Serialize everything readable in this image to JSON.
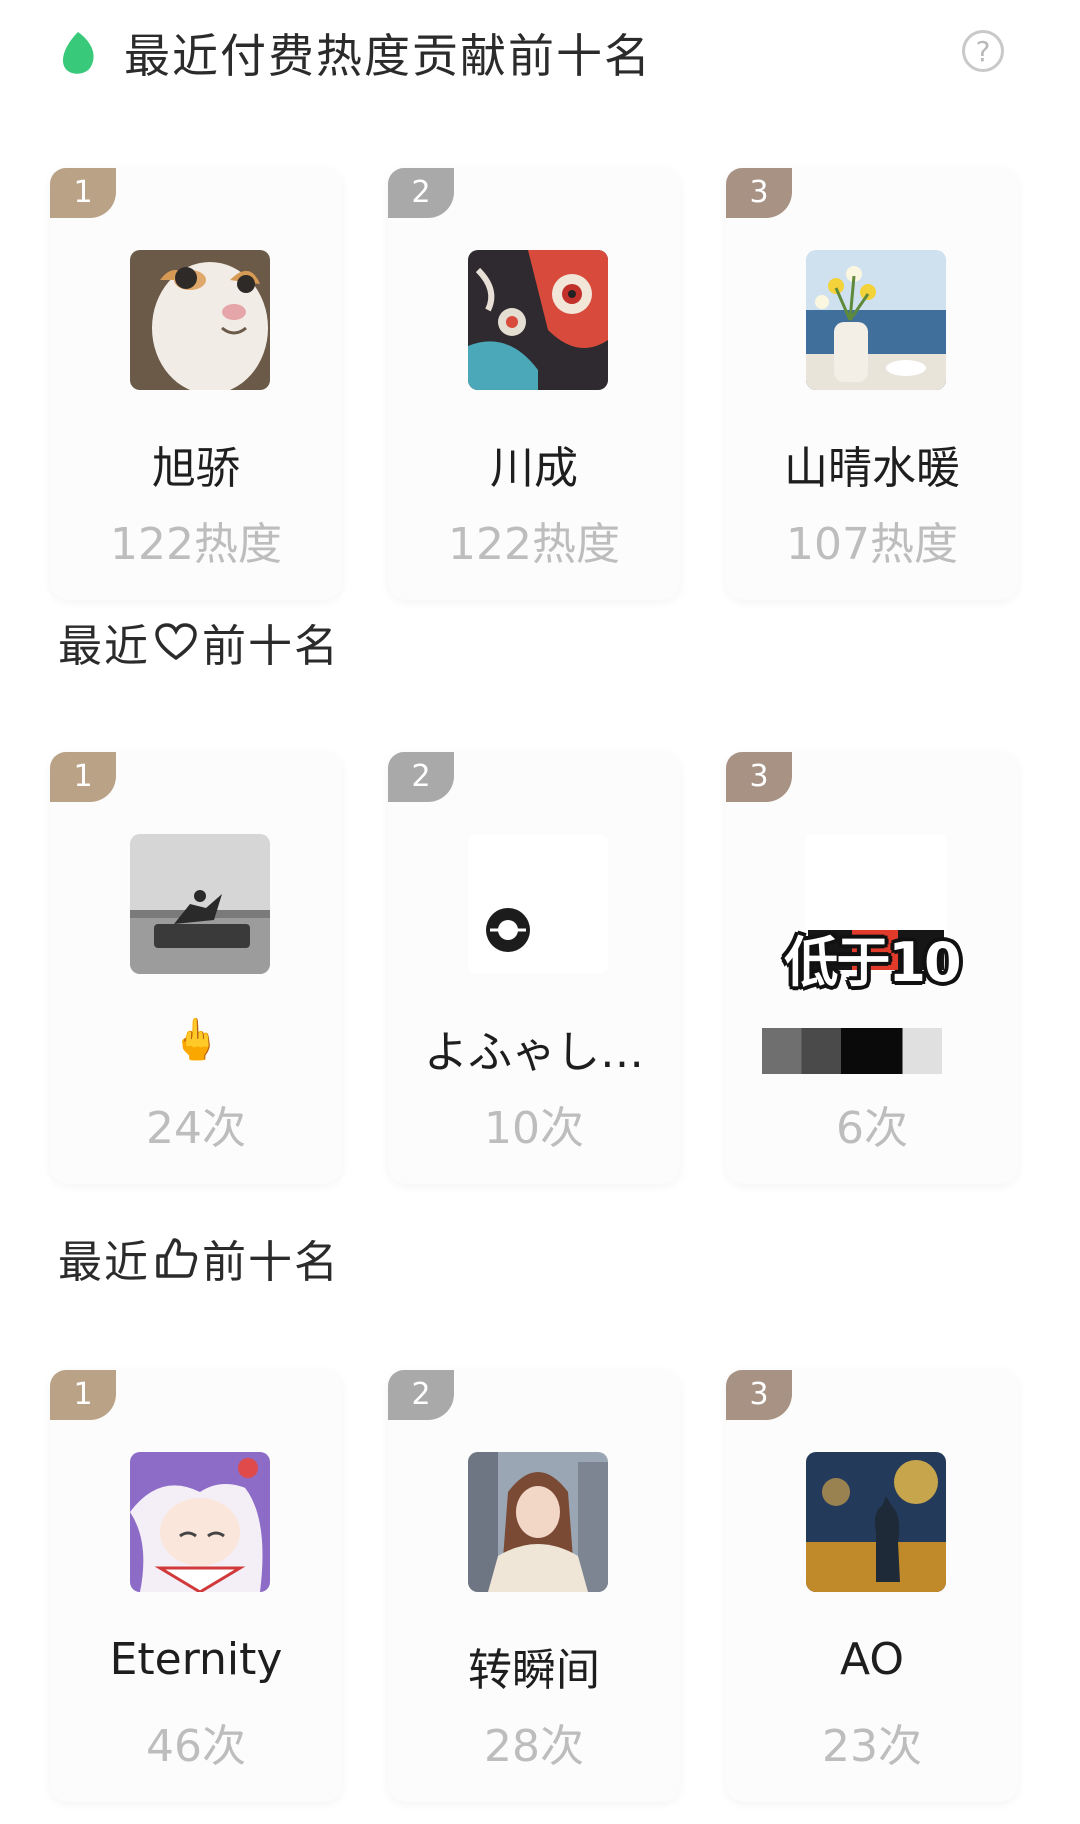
{
  "paid_section": {
    "title": "最近付费热度贡献前十名",
    "help_icon": "?",
    "cards": [
      {
        "rank": "1",
        "name": "旭骄",
        "value": "122热度"
      },
      {
        "rank": "2",
        "name": "川成",
        "value": "122热度"
      },
      {
        "rank": "3",
        "name": "山晴水暖",
        "value": "107热度"
      }
    ]
  },
  "heart_section": {
    "title_prefix": "最近",
    "title_suffix": "前十名",
    "title_icon": "heart-outline-icon",
    "cards": [
      {
        "rank": "1",
        "name": "🖕",
        "value": "24次"
      },
      {
        "rank": "2",
        "name": "よふゃし…",
        "value": "10次"
      },
      {
        "rank": "3",
        "name": "",
        "value": "6次",
        "overlay": "低于10"
      }
    ]
  },
  "like_section": {
    "title_prefix": "最近",
    "title_suffix": "前十名",
    "title_icon": "thumbs-up-outline-icon",
    "cards": [
      {
        "rank": "1",
        "name": "Eternity",
        "value": "46次"
      },
      {
        "rank": "2",
        "name": "转瞬间",
        "value": "28次"
      },
      {
        "rank": "3",
        "name": "AO",
        "value": "23次"
      }
    ]
  },
  "colors": {
    "accent_leaf": "#39c97a",
    "rank_gold": "#b9a286",
    "rank_silver": "#a9a9a9",
    "rank_bronze": "#a89284",
    "value_gray": "#bdbdbd"
  }
}
